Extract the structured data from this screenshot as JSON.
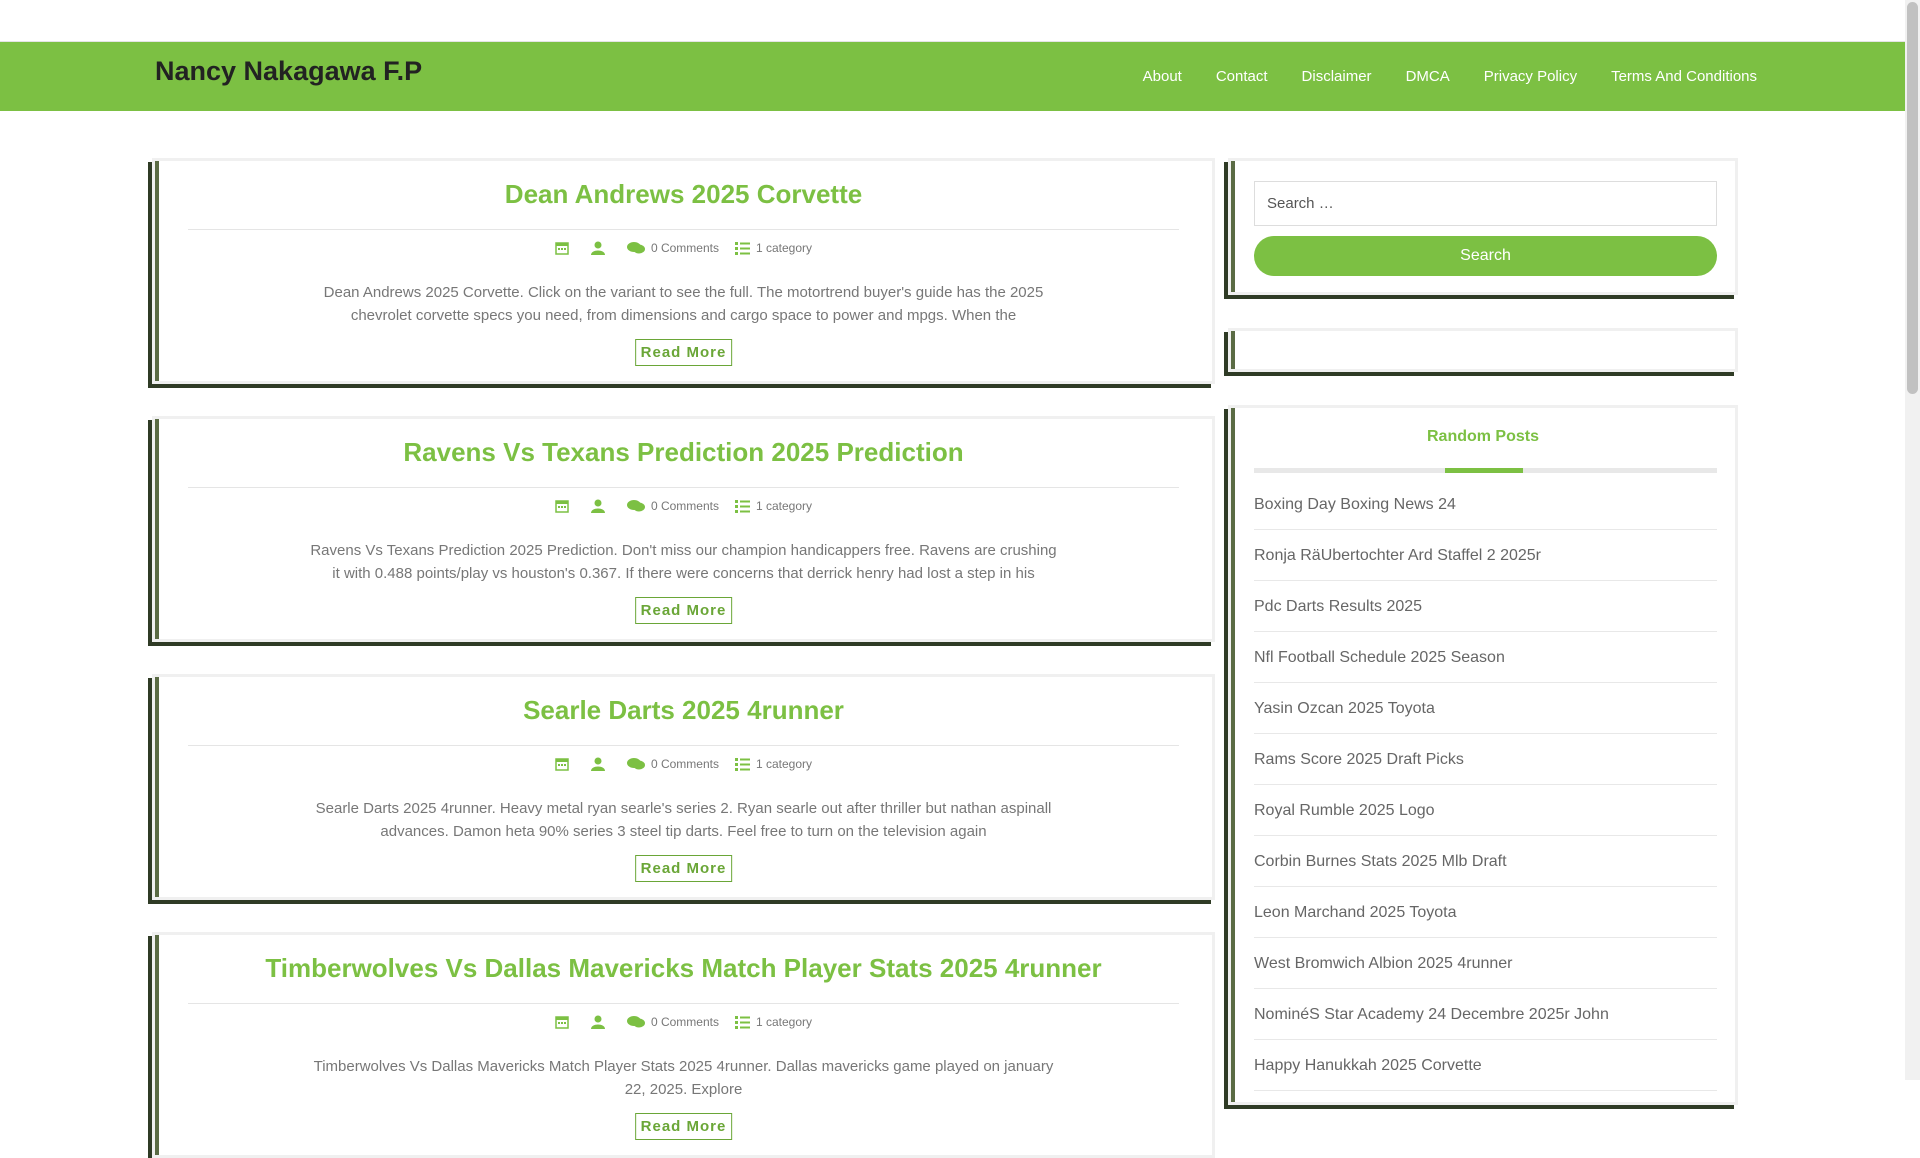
{
  "site": {
    "title": "Nancy Nakagawa F.P"
  },
  "nav": {
    "items": [
      "About",
      "Contact",
      "Disclaimer",
      "DMCA",
      "Privacy Policy",
      "Terms And Conditions"
    ]
  },
  "colors": {
    "accent": "#7cc043",
    "title_text": "#222222",
    "shadow": "#2f3b25"
  },
  "posts": [
    {
      "title": "Dean Andrews 2025 Corvette",
      "comments": "0 Comments",
      "category": "1 category",
      "excerpt": "Dean Andrews 2025 Corvette. Click on the variant to see the full. The motortrend buyer's guide has the 2025 chevrolet corvette specs you need, from dimensions and cargo space to power and mpgs. When the",
      "read_more": "Read More"
    },
    {
      "title": "Ravens Vs Texans Prediction 2025 Prediction",
      "comments": "0 Comments",
      "category": "1 category",
      "excerpt": "Ravens Vs Texans Prediction 2025 Prediction. Don't miss our champion handicappers free. Ravens are crushing it with 0.488 points/play vs houston's 0.367. If there were concerns that derrick henry had lost a step in his",
      "read_more": "Read More"
    },
    {
      "title": "Searle Darts 2025 4runner",
      "comments": "0 Comments",
      "category": "1 category",
      "excerpt": "Searle Darts 2025 4runner. Heavy metal ryan searle's series 2. Ryan searle out after thriller but nathan aspinall advances. Damon heta 90% series 3 steel tip darts. Feel free to turn on the television again",
      "read_more": "Read More"
    },
    {
      "title": "Timberwolves Vs Dallas Mavericks Match Player Stats 2025 4runner",
      "comments": "0 Comments",
      "category": "1 category",
      "excerpt": "Timberwolves Vs Dallas Mavericks Match Player Stats 2025 4runner. Dallas mavericks game played on january 22, 2025. Explore",
      "read_more": "Read More"
    }
  ],
  "icons": {
    "date": "calendar-icon",
    "author": "user-icon",
    "comments": "comments-icon",
    "category": "list-icon"
  },
  "search": {
    "placeholder": "Search …",
    "button": "Search"
  },
  "random_posts": {
    "title": "Random Posts",
    "items": [
      "Boxing Day Boxing News 24",
      "Ronja RäUbertochter Ard Staffel 2 2025r",
      "Pdc Darts Results 2025",
      "Nfl Football Schedule 2025 Season",
      "Yasin Ozcan 2025 Toyota",
      "Rams Score 2025 Draft Picks",
      "Royal Rumble 2025 Logo",
      "Corbin Burnes Stats 2025 Mlb Draft",
      "Leon Marchand 2025 Toyota",
      "West Bromwich Albion 2025 4runner",
      "NominéS Star Academy 24 Decembre 2025r John",
      "Happy Hanukkah 2025 Corvette"
    ]
  }
}
